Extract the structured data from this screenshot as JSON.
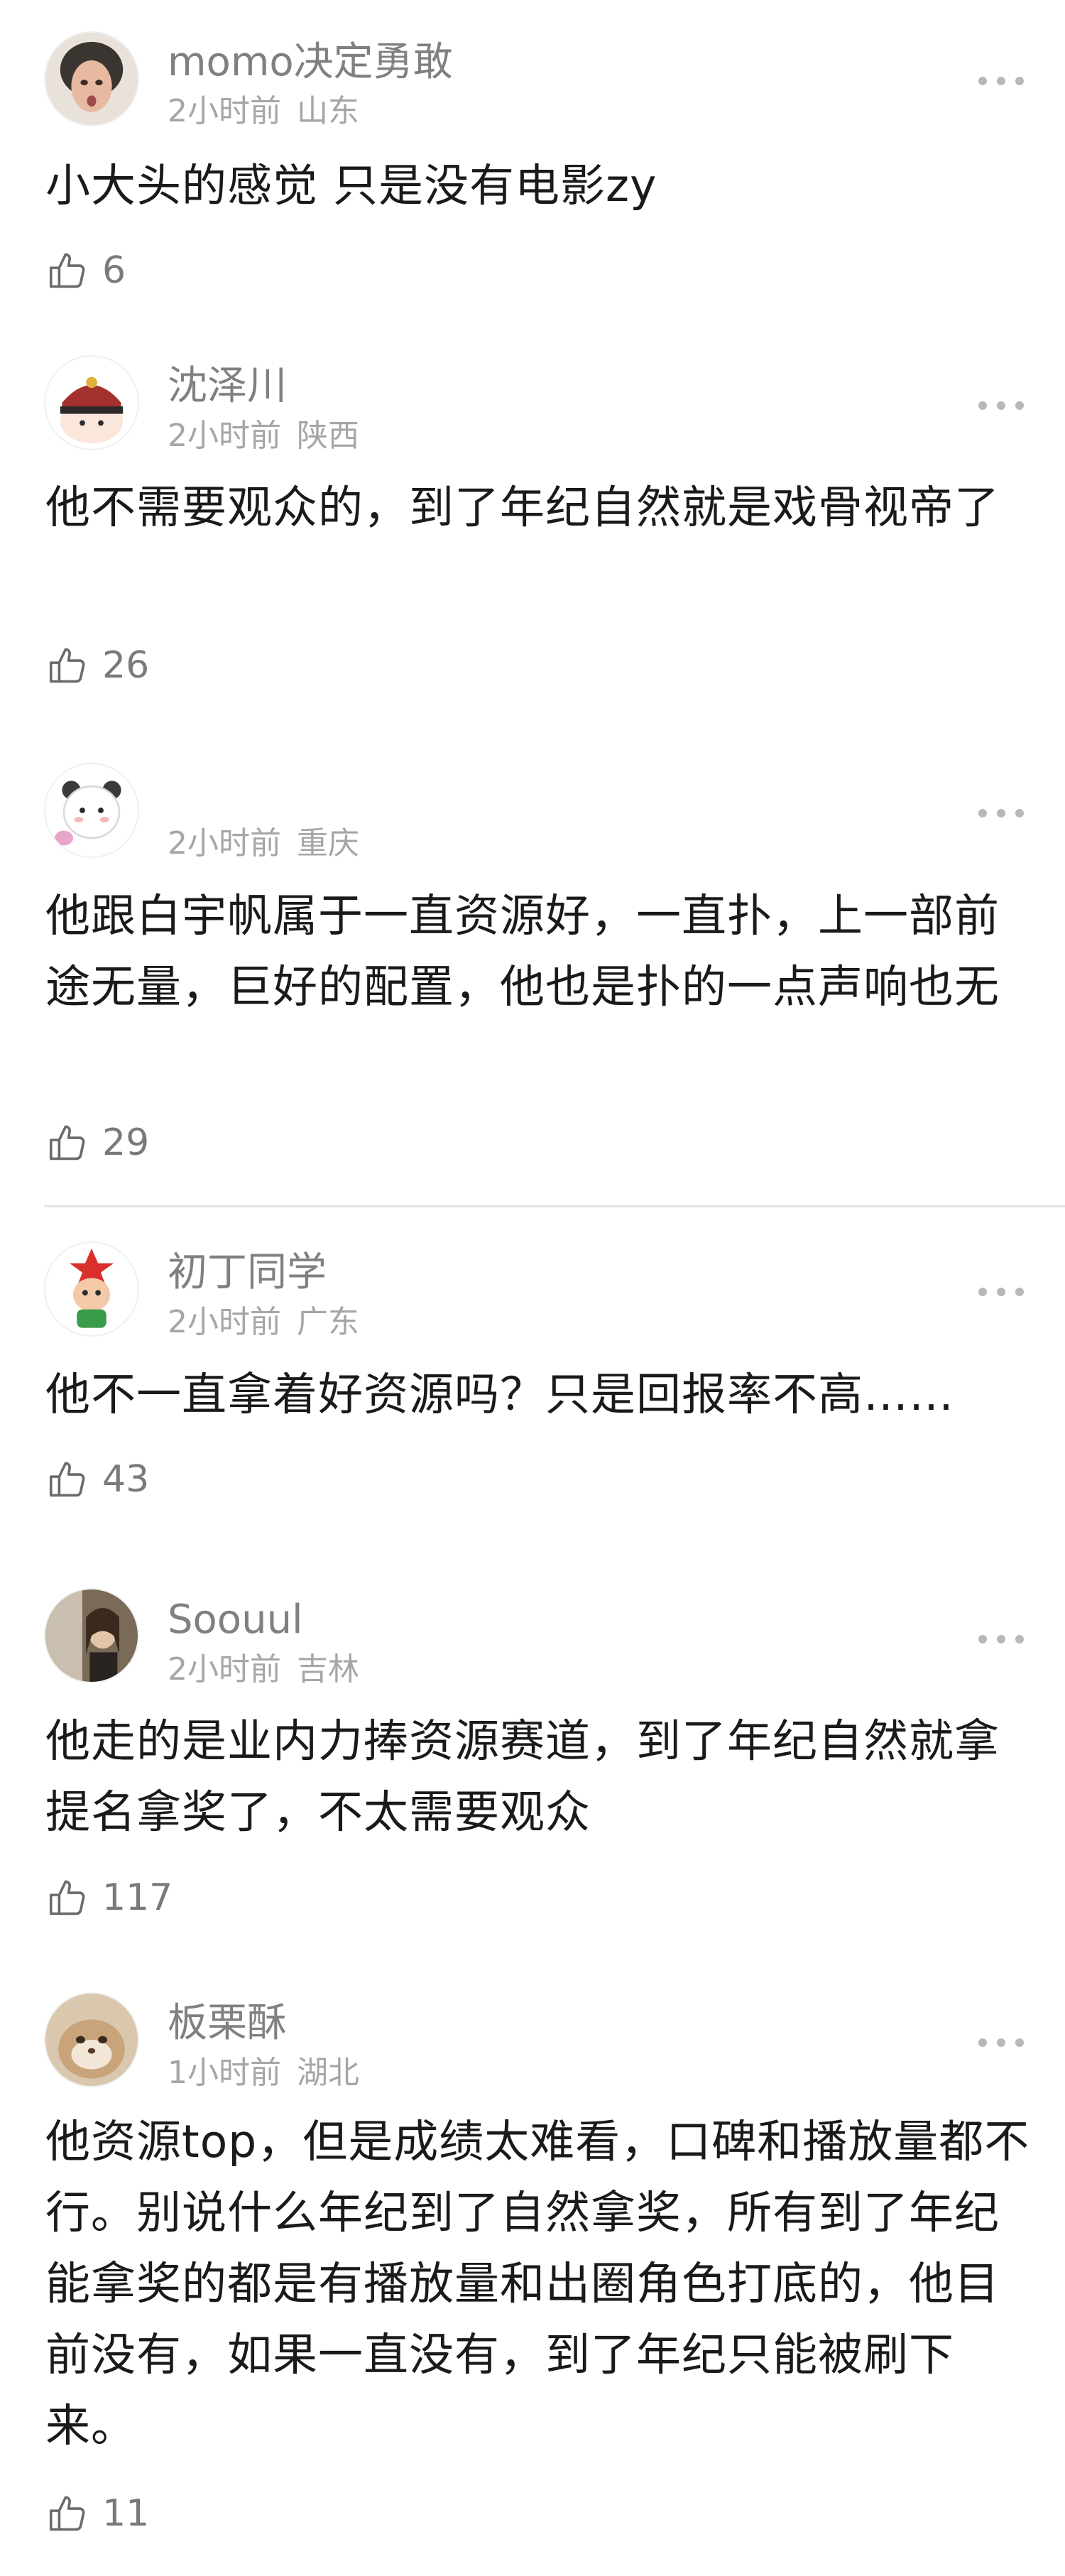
{
  "comments": [
    {
      "username": "momo决定勇敢",
      "time": "2小时前",
      "location": "山东",
      "text": "小大头的感觉 只是没有电影zy",
      "likes": "6"
    },
    {
      "username": "沈泽川",
      "time": "2小时前",
      "location": "陕西",
      "text": "他不需要观众的，到了年纪自然就是戏骨视帝了",
      "likes": "26"
    },
    {
      "username": "",
      "time": "2小时前",
      "location": "重庆",
      "text": "他跟白宇帆属于一直资源好，一直扑，上一部前途无量，巨好的配置，他也是扑的一点声响也无",
      "likes": "29"
    },
    {
      "username": "初丁同学",
      "time": "2小时前",
      "location": "广东",
      "text": "他不一直拿着好资源吗？只是回报率不高……",
      "likes": "43"
    },
    {
      "username": "Soouul",
      "time": "2小时前",
      "location": "吉林",
      "text": "他走的是业内力捧资源赛道，到了年纪自然就拿提名拿奖了，不太需要观众",
      "likes": "117"
    },
    {
      "username": "板栗酥",
      "time": "1小时前",
      "location": "湖北",
      "text": "他资源top，但是成绩太难看，口碑和播放量都不行。别说什么年纪到了自然拿奖，所有到了年纪能拿奖的都是有播放量和出圈角色打底的，他目前没有，如果一直没有，到了年纪只能被刷下来。",
      "likes": "11"
    }
  ]
}
